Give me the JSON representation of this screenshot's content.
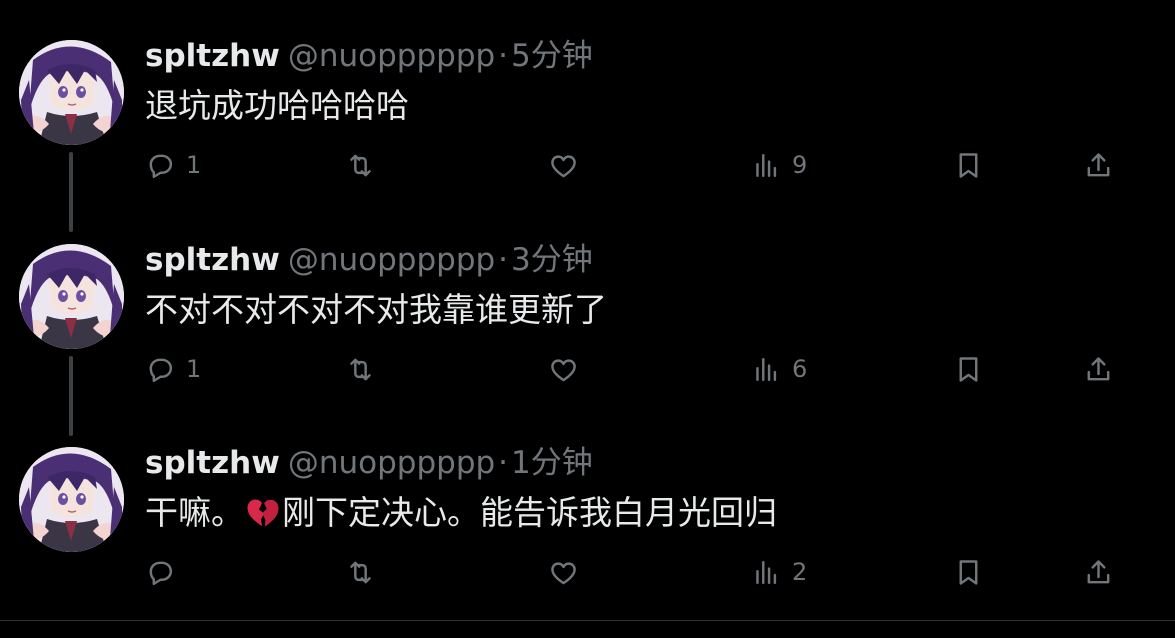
{
  "colors": {
    "background": "#000000",
    "text_primary": "#e7e9ea",
    "text_secondary": "#71767b",
    "heartbreak": "#d8294a"
  },
  "tweets": [
    {
      "author": {
        "display_name": "spltzhw",
        "handle": "@nuopppppp"
      },
      "separator": "·",
      "time": "5分钟",
      "text": "退坑成功哈哈哈哈",
      "stats": {
        "replies": "1",
        "retweets": "",
        "likes": "",
        "views": "9"
      }
    },
    {
      "author": {
        "display_name": "spltzhw",
        "handle": "@nuopppppp"
      },
      "separator": "·",
      "time": "3分钟",
      "text": "不对不对不对不对我靠谁更新了",
      "stats": {
        "replies": "1",
        "retweets": "",
        "likes": "",
        "views": "6"
      }
    },
    {
      "author": {
        "display_name": "spltzhw",
        "handle": "@nuopppppp"
      },
      "separator": "·",
      "time": "1分钟",
      "text_before_emoji": "干嘛。",
      "emoji": "broken-heart-icon",
      "text_after_emoji": "刚下定决心。能告诉我白月光回归",
      "stats": {
        "replies": "",
        "retweets": "",
        "likes": "",
        "views": "2"
      }
    }
  ],
  "icons": [
    "reply-icon",
    "retweet-icon",
    "like-icon",
    "views-icon",
    "bookmark-icon",
    "share-icon"
  ]
}
